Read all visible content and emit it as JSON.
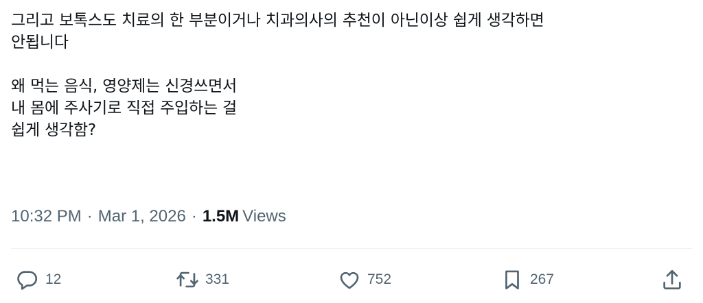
{
  "tweet": {
    "line1": "그리고 보톡스도 치료의 한 부분이거나 치과의사의 추천이 아닌이상 쉽게 생각하면",
    "line2": "안됩니다",
    "line3": "왜 먹는 음식, 영양제는 신경쓰면서",
    "line4": "내 몸에 주사기로 직접 주입하는 걸",
    "line5": "쉽게 생각함?"
  },
  "meta": {
    "time": "10:32 PM",
    "separator": "·",
    "date": "Mar 1, 2026",
    "views_count": "1.5M",
    "views_label": "Views"
  },
  "actions": {
    "reply": {
      "icon": "reply-icon",
      "count": "12"
    },
    "retweet": {
      "icon": "retweet-icon",
      "count": "331"
    },
    "like": {
      "icon": "heart-icon",
      "count": "752"
    },
    "bookmark": {
      "icon": "bookmark-icon",
      "count": "267"
    },
    "share": {
      "icon": "share-icon"
    }
  },
  "colors": {
    "text": "#0f1419",
    "secondary": "#536471",
    "divider": "#eff3f4"
  }
}
